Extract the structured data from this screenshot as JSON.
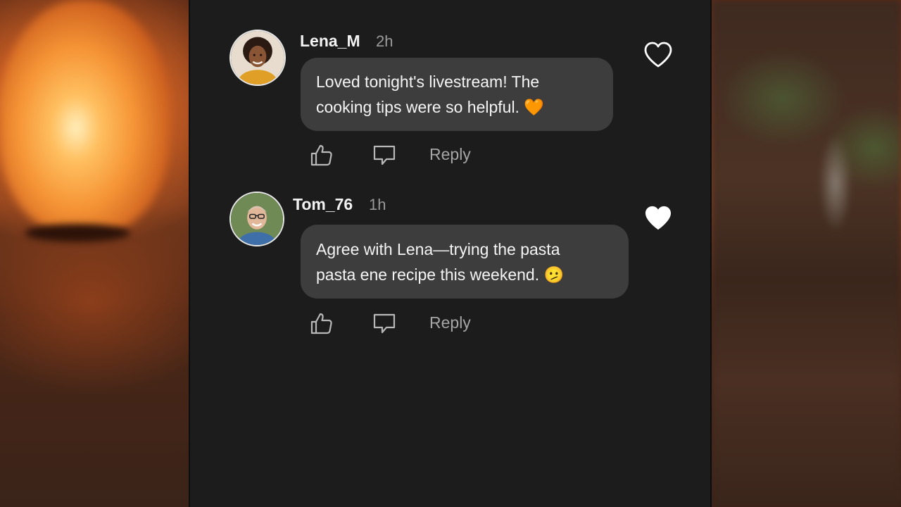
{
  "comments": [
    {
      "username": "Lena_M",
      "time": "2h",
      "text": "Loved tonight's livestream! The\ncooking tips were so helpful. 🧡",
      "reply_label": "Reply",
      "liked": false
    },
    {
      "username": "Tom_76",
      "time": "1h",
      "text": "Agree with Lena—trying the pasta\npasta ene recipe this weekend. 🫤",
      "reply_label": "Reply",
      "liked": true
    }
  ],
  "colors": {
    "phone_background": "#1c1c1c",
    "bubble": "#3d3d3d",
    "heart_outline": "#ffffff",
    "heart_filled": "#ffffff"
  },
  "icons": {
    "like": "thumbs-up-icon",
    "comment": "comment-bubble-icon",
    "heart_empty": "heart-outline-icon",
    "heart_filled": "heart-filled-icon"
  }
}
